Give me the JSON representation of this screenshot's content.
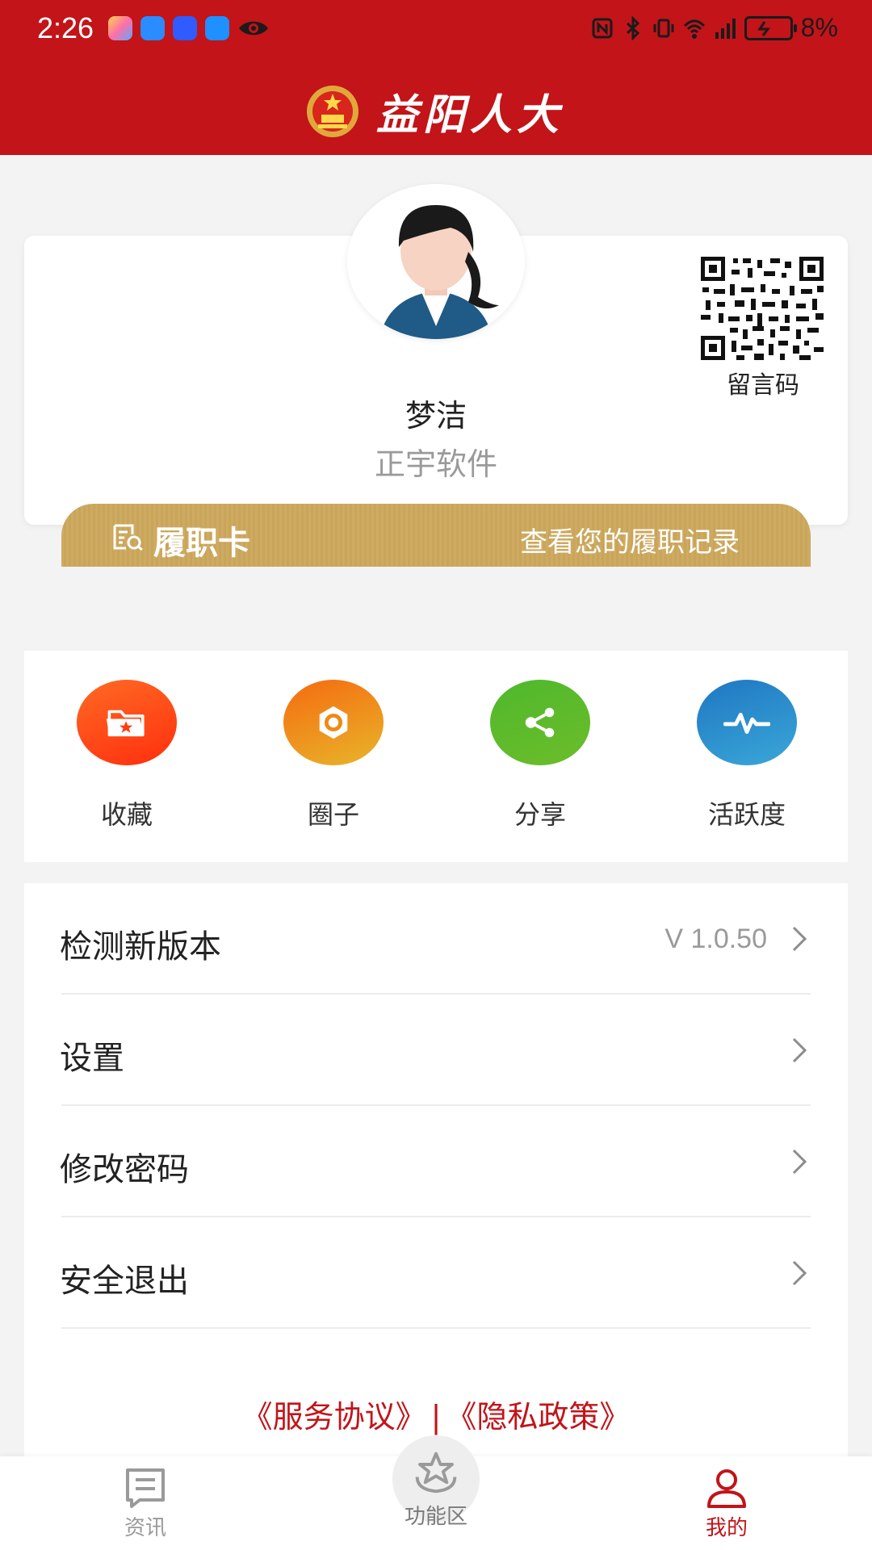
{
  "status_bar": {
    "time": "2:26",
    "battery": "8%"
  },
  "header": {
    "app_name": "益阳人大"
  },
  "profile": {
    "name": "梦洁",
    "organization": "正宇软件",
    "qr_label": "留言码"
  },
  "duty_card": {
    "title": "履职卡",
    "link": "查看您的履职记录"
  },
  "quick_actions": [
    {
      "label": "收藏",
      "icon": "folder-star-icon",
      "color": "#ff4d1a"
    },
    {
      "label": "圈子",
      "icon": "hexagon-nut-icon",
      "color": "#ee7d14"
    },
    {
      "label": "分享",
      "icon": "share-icon",
      "color": "#5cb82a"
    },
    {
      "label": "活跃度",
      "icon": "pulse-icon",
      "color": "#2287c8"
    }
  ],
  "menu": {
    "items": [
      {
        "label": "检测新版本",
        "value": "V 1.0.50"
      },
      {
        "label": "设置"
      },
      {
        "label": "修改密码"
      },
      {
        "label": "安全退出"
      }
    ]
  },
  "legal": {
    "service": "《服务协议》",
    "separator": "|",
    "privacy": "《隐私政策》"
  },
  "bottom_nav": [
    {
      "label": "资讯",
      "icon": "news-icon",
      "active": false
    },
    {
      "label": "功能区",
      "icon": "star-crown-icon",
      "active": false
    },
    {
      "label": "我的",
      "icon": "user-icon",
      "active": true
    }
  ],
  "colors": {
    "brand_red": "#c21419",
    "gold": "#cfab62",
    "inactive_gray": "#9a9a9a"
  }
}
